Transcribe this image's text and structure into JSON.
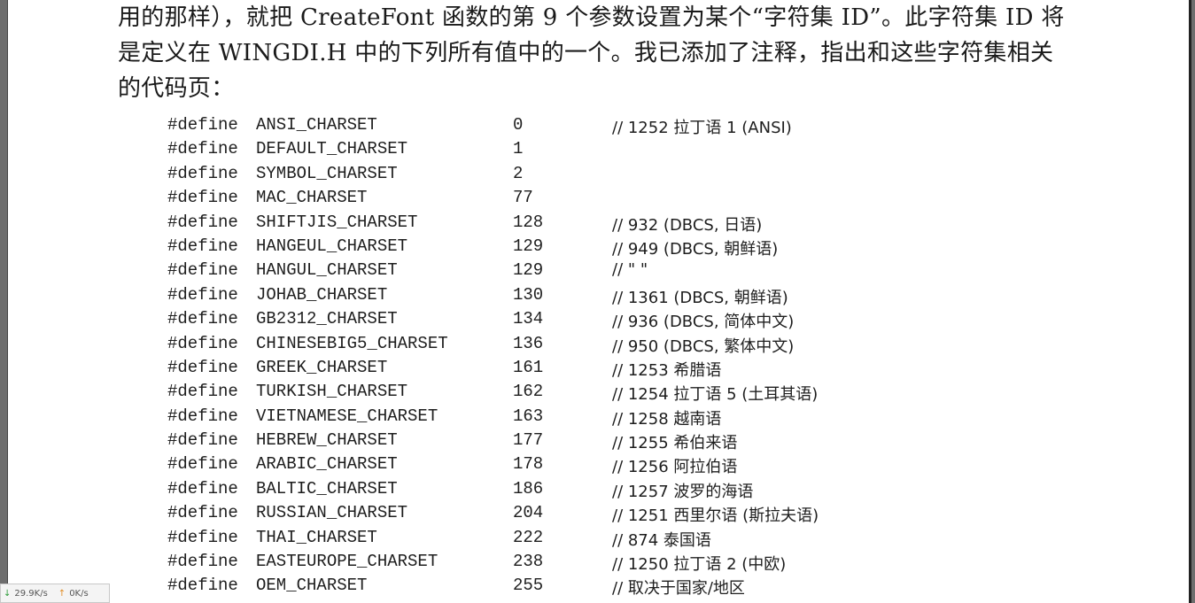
{
  "paragraph": {
    "lines": [
      "用的那样），就把 CreateFont 函数的第 9 个参数设置为某个“字符集 ID”。此字符集 ID 将",
      "是定义在 WINGDI.H 中的下列所有值中的一个。我已添加了注释，指出和这些字符集相关",
      "的代码页："
    ]
  },
  "code": {
    "rows": [
      {
        "kw": "#define",
        "name": "ANSI_CHARSET",
        "value": "0",
        "comment": "// 1252 拉丁语 1 (ANSI)"
      },
      {
        "kw": "#define",
        "name": "DEFAULT_CHARSET",
        "value": "1",
        "comment": ""
      },
      {
        "kw": "#define",
        "name": "SYMBOL_CHARSET",
        "value": "2",
        "comment": ""
      },
      {
        "kw": "#define",
        "name": "MAC_CHARSET",
        "value": "77",
        "comment": ""
      },
      {
        "kw": "#define",
        "name": "SHIFTJIS_CHARSET",
        "value": "128",
        "comment": "// 932 (DBCS, 日语)"
      },
      {
        "kw": "#define",
        "name": "HANGEUL_CHARSET",
        "value": "129",
        "comment": "// 949 (DBCS, 朝鲜语)"
      },
      {
        "kw": "#define",
        "name": "HANGUL_CHARSET",
        "value": "129",
        "comment": "// \" \""
      },
      {
        "kw": "#define",
        "name": "JOHAB_CHARSET",
        "value": "130",
        "comment": "// 1361 (DBCS, 朝鲜语)"
      },
      {
        "kw": "#define",
        "name": "GB2312_CHARSET",
        "value": "134",
        "comment": "// 936 (DBCS, 简体中文)"
      },
      {
        "kw": "#define",
        "name": "CHINESEBIG5_CHARSET",
        "value": "136",
        "comment": "// 950 (DBCS, 繁体中文)"
      },
      {
        "kw": "#define",
        "name": "GREEK_CHARSET",
        "value": "161",
        "comment": "// 1253 希腊语"
      },
      {
        "kw": "#define",
        "name": "TURKISH_CHARSET",
        "value": "162",
        "comment": "// 1254 拉丁语 5 (土耳其语)"
      },
      {
        "kw": "#define",
        "name": "VIETNAMESE_CHARSET",
        "value": "163",
        "comment": "// 1258 越南语"
      },
      {
        "kw": "#define",
        "name": "HEBREW_CHARSET",
        "value": "177",
        "comment": "// 1255 希伯来语"
      },
      {
        "kw": "#define",
        "name": "ARABIC_CHARSET",
        "value": "178",
        "comment": "// 1256 阿拉伯语"
      },
      {
        "kw": "#define",
        "name": "BALTIC_CHARSET",
        "value": "186",
        "comment": "// 1257 波罗的海语"
      },
      {
        "kw": "#define",
        "name": "RUSSIAN_CHARSET",
        "value": "204",
        "comment": "// 1251 西里尔语 (斯拉夫语)"
      },
      {
        "kw": "#define",
        "name": "THAI_CHARSET",
        "value": "222",
        "comment": "// 874 泰国语"
      },
      {
        "kw": "#define",
        "name": "EASTEUROPE_CHARSET",
        "value": "238",
        "comment": "// 1250 拉丁语 2 (中欧)"
      },
      {
        "kw": "#define",
        "name": "OEM_CHARSET",
        "value": "255",
        "comment": "// 取决于国家/地区"
      }
    ]
  },
  "network_widget": {
    "download_icon": "arrow-down-icon",
    "download_speed": "29.9K/s",
    "upload_icon": "arrow-up-icon",
    "upload_speed": "0K/s",
    "colors": {
      "download": "#2e9b3a",
      "upload": "#e08a1e"
    }
  }
}
